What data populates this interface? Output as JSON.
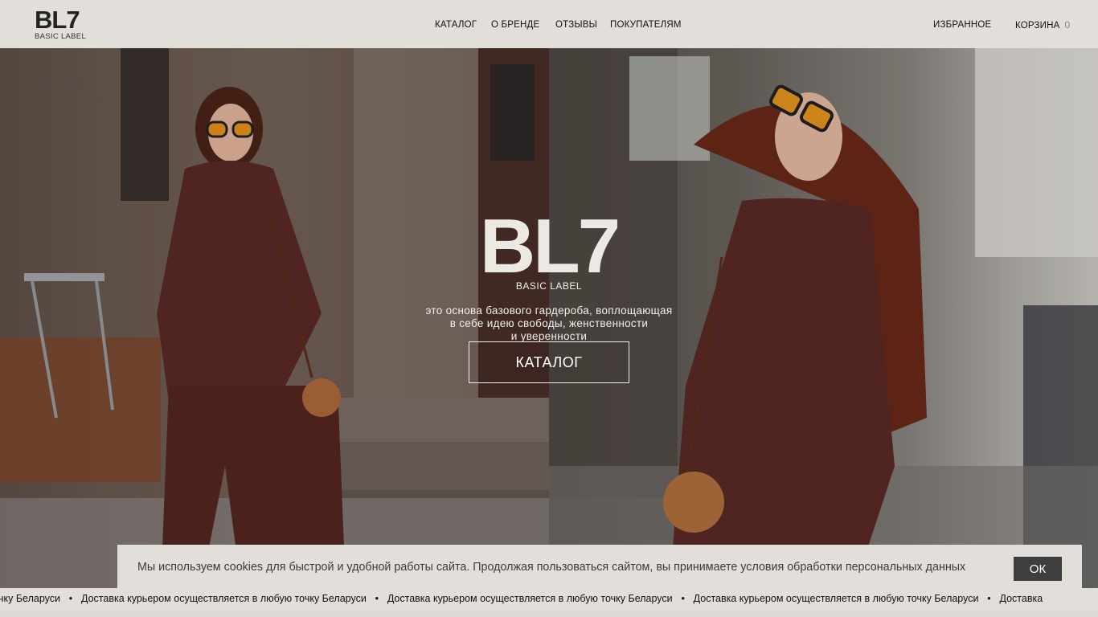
{
  "header": {
    "logo": {
      "main": "BL7",
      "sub": "BASIC LABEL"
    },
    "nav": [
      "КАТАЛОГ",
      "О БРЕНДЕ",
      "ОТЗЫВЫ",
      "ПОКУПАТЕЛЯМ"
    ],
    "favorites_label": "ИЗБРАННОЕ",
    "cart_label": "КОРЗИНА",
    "cart_count": "0"
  },
  "hero": {
    "ghost_label": "BASIC LABEL",
    "title": "BL7",
    "subtitle": "BASIC LABEL",
    "tagline": [
      "это основа базового гардероба, воплощающая",
      "в себе идею свободы, женственности",
      "и уверенности"
    ],
    "cta_label": "КАТАЛОГ"
  },
  "cookie": {
    "text": "Мы используем cookies для быстрой и удобной работы сайта. Продолжая пользоваться сайтом, вы принимаете условия обработки персональных данных",
    "button_label": "ОК"
  },
  "ticker": {
    "first_fragment": "чку Беларуси",
    "message": "Доставка курьером осуществляется в любую точку Беларуси",
    "last_fragment": "Доставка",
    "separator": "•"
  },
  "colors": {
    "background": "#e2dfda",
    "button_dark": "#3e3e3e",
    "outfit": "#5a2a26"
  }
}
